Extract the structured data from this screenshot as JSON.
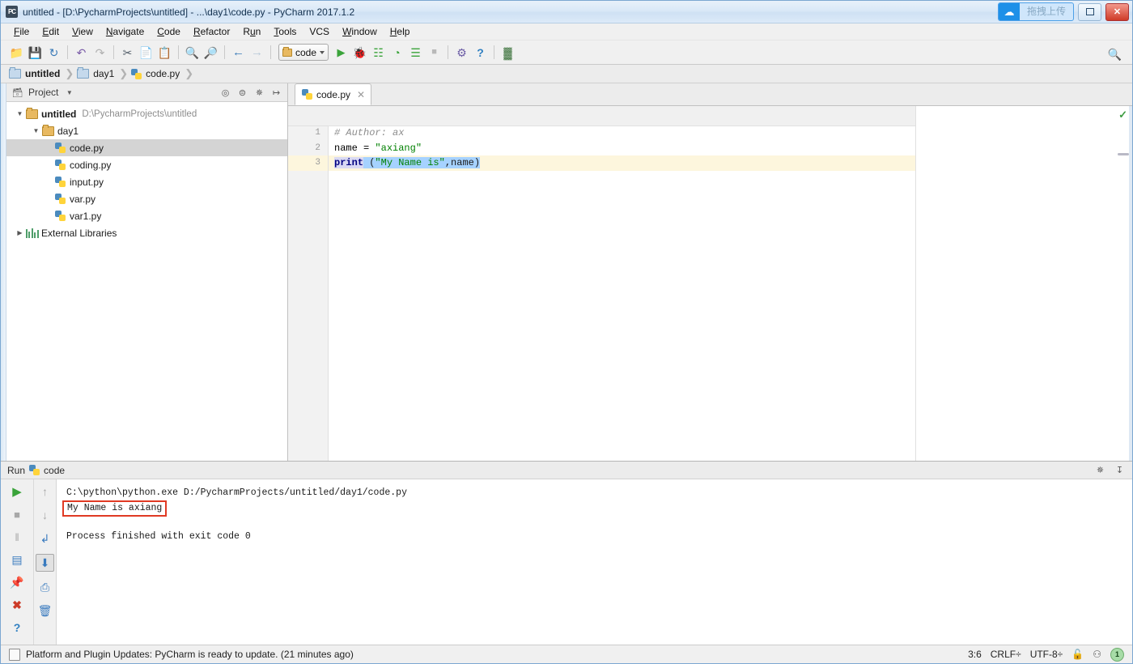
{
  "window": {
    "title": "untitled - [D:\\PycharmProjects\\untitled] - ...\\day1\\code.py - PyCharm 2017.1.2",
    "app_icon_text": "PC",
    "upload_widget_label": "拖拽上传",
    "restore_label": "▫",
    "close_label": "✕"
  },
  "menubar": {
    "items": [
      {
        "label": "File"
      },
      {
        "label": "Edit"
      },
      {
        "label": "View"
      },
      {
        "label": "Navigate"
      },
      {
        "label": "Code"
      },
      {
        "label": "Refactor"
      },
      {
        "label": "Run"
      },
      {
        "label": "Tools"
      },
      {
        "label": "VCS"
      },
      {
        "label": "Window"
      },
      {
        "label": "Help"
      }
    ]
  },
  "toolbar": {
    "run_config_name": "code",
    "buttons": [
      {
        "name": "open-icon",
        "glyph": "📂"
      },
      {
        "name": "save-all-icon",
        "glyph": "💾"
      },
      {
        "name": "sync-icon",
        "glyph": "↻"
      },
      {
        "name": "undo-icon",
        "glyph": "↶"
      },
      {
        "name": "redo-icon",
        "glyph": "↷"
      },
      {
        "name": "cut-icon",
        "glyph": "✂"
      },
      {
        "name": "copy-icon",
        "glyph": "❐"
      },
      {
        "name": "paste-icon",
        "glyph": "📋"
      },
      {
        "name": "find-icon",
        "glyph": "🔍"
      },
      {
        "name": "replace-icon",
        "glyph": "🔎"
      },
      {
        "name": "back-icon",
        "glyph": "←"
      },
      {
        "name": "forward-icon",
        "glyph": "→"
      }
    ],
    "run_buttons": [
      {
        "name": "run-icon",
        "glyph": "▶",
        "color": "#3aa33a"
      },
      {
        "name": "debug-icon",
        "glyph": "🐞",
        "color": "#3aa33a"
      },
      {
        "name": "coverage-icon",
        "glyph": "☷",
        "color": "#3aa33a"
      },
      {
        "name": "profile-icon",
        "glyph": "◔",
        "color": "#3aa33a"
      },
      {
        "name": "rerun-icon",
        "glyph": "☰",
        "color": "#3aa33a"
      },
      {
        "name": "stop-icon",
        "glyph": "■",
        "color": "#b0b0b0"
      }
    ],
    "tail_buttons": [
      {
        "name": "update-project-icon",
        "glyph": "⚙",
        "color": "#6b5ca5"
      },
      {
        "name": "help-icon",
        "glyph": "?",
        "color": "#2f7fc1"
      },
      {
        "name": "settings-icon",
        "glyph": "▓",
        "color": "#4a7c4a"
      }
    ],
    "search_icon": "🔍"
  },
  "breadcrumb": {
    "items": [
      {
        "label": "untitled",
        "icon": "folder-icon"
      },
      {
        "label": "day1",
        "icon": "folder-icon"
      },
      {
        "label": "code.py",
        "icon": "python-file-icon"
      }
    ],
    "separator": "❯"
  },
  "project_panel": {
    "title": "Project",
    "dropdown_caret": "▾",
    "head_icons": [
      {
        "name": "collapse-target-icon",
        "glyph": "⌖"
      },
      {
        "name": "collapse-all-icon",
        "glyph": "──"
      },
      {
        "name": "settings-gear-icon",
        "glyph": "⚙"
      },
      {
        "name": "hide-panel-icon",
        "glyph": "⇥"
      }
    ],
    "tree": [
      {
        "label": "untitled",
        "path": "D:\\PycharmProjects\\untitled",
        "icon": "folder-open-icon",
        "indent": 0,
        "twisty": "▼",
        "bold": true,
        "selected": false
      },
      {
        "label": "day1",
        "path": "",
        "icon": "folder-open-icon",
        "indent": 1,
        "twisty": "▼",
        "bold": false,
        "selected": false
      },
      {
        "label": "code.py",
        "path": "",
        "icon": "python-file-icon",
        "indent": 2,
        "twisty": "",
        "bold": false,
        "selected": true
      },
      {
        "label": "coding.py",
        "path": "",
        "icon": "python-file-icon",
        "indent": 2,
        "twisty": "",
        "bold": false,
        "selected": false
      },
      {
        "label": "input.py",
        "path": "",
        "icon": "python-file-icon",
        "indent": 2,
        "twisty": "",
        "bold": false,
        "selected": false
      },
      {
        "label": "var.py",
        "path": "",
        "icon": "python-file-icon",
        "indent": 2,
        "twisty": "",
        "bold": false,
        "selected": false
      },
      {
        "label": "var1.py",
        "path": "",
        "icon": "python-file-icon",
        "indent": 2,
        "twisty": "",
        "bold": false,
        "selected": false
      },
      {
        "label": "External Libraries",
        "path": "",
        "icon": "library-icon",
        "indent": 0,
        "twisty": "▶",
        "bold": false,
        "selected": false
      }
    ]
  },
  "editor": {
    "tab_label": "code.py",
    "tab_close": "✕",
    "inspection_status_icon": "✓",
    "lines": [
      {
        "num": "1",
        "current": false
      },
      {
        "num": "2",
        "current": false
      },
      {
        "num": "3",
        "current": true
      }
    ],
    "code": {
      "line1_comment": "# Author: ax",
      "line2_name": "name = ",
      "line2_string": "\"axiang\"",
      "line3_kw": "print",
      "line3_sel_open": " (",
      "line3_str": "\"My Name is\"",
      "line3_mid": ",name",
      "line3_sel_close": ")"
    }
  },
  "run_panel": {
    "tab_label": "Run",
    "config_label": "code",
    "left_buttons": [
      {
        "name": "rerun-button",
        "glyph": "▶",
        "color": "#3aa33a"
      },
      {
        "name": "stop-button",
        "glyph": "■",
        "color": "#9a9a9a"
      },
      {
        "name": "pause-button",
        "glyph": "‖",
        "color": "#9a9a9a"
      },
      {
        "name": "restore-layout-button",
        "glyph": "▤",
        "color": "#3a7bbf"
      },
      {
        "name": "pin-tab-button",
        "glyph": "📌",
        "color": "#6b4f9e"
      },
      {
        "name": "close-button",
        "glyph": "✕",
        "color": "#cc3b28"
      },
      {
        "name": "help-button",
        "glyph": "?",
        "color": "#2f7fc1"
      }
    ],
    "right_buttons": [
      {
        "name": "scroll-up-button",
        "glyph": "↑",
        "color": "#9a9a9a"
      },
      {
        "name": "scroll-down-button",
        "glyph": "↓",
        "color": "#9a9a9a"
      },
      {
        "name": "soft-wrap-button",
        "glyph": "↲",
        "color": "#3a7bbf"
      },
      {
        "name": "scroll-to-end-button",
        "glyph": "⬇",
        "color": "#3a7bbf"
      },
      {
        "name": "print-button",
        "glyph": "⎙",
        "color": "#3a7bbf"
      },
      {
        "name": "clear-all-button",
        "glyph": "🗑",
        "color": "#3a7bbf"
      }
    ],
    "header_icons": [
      {
        "name": "settings-gear-icon",
        "glyph": "⚙"
      },
      {
        "name": "hide-panel-icon",
        "glyph": "⤓"
      }
    ],
    "console": {
      "command": "C:\\python\\python.exe D:/PycharmProjects/untitled/day1/code.py",
      "output": "My Name is axiang",
      "exit": "Process finished with exit code 0",
      "highlight_color": "#e03a24"
    }
  },
  "statusbar": {
    "message": "Platform and Plugin Updates: PyCharm is ready to update. (21 minutes ago)",
    "caret_position": "3:6",
    "line_separator": "CRLF÷",
    "encoding": "UTF-8÷",
    "lock_icon": "🔓",
    "inspector_icon": "⚇",
    "notification_count": "1"
  }
}
